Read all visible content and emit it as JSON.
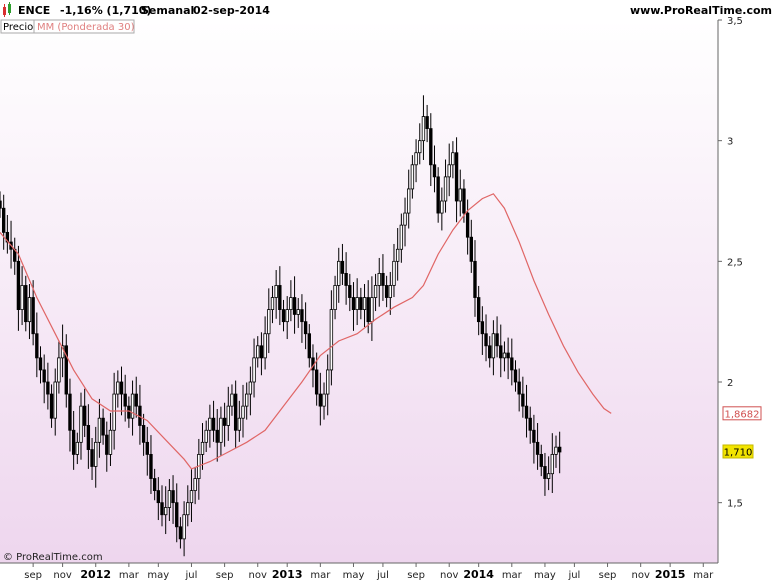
{
  "header": {
    "symbol": "ENCE",
    "change": "-1,16% (1,710)",
    "period": "Semanal",
    "date": "02-sep-2014",
    "website": "www.ProRealTime.com"
  },
  "legend": {
    "price_label": "Precio",
    "ma_label": "MM (Ponderada 30)"
  },
  "watermark": "© ProRealTime.com",
  "colors": {
    "background_top": "#ffffff",
    "background_bottom": "#f0d8f0",
    "candle": "#000000",
    "ma_line": "#e06666",
    "price_badge": "#f2e400",
    "ma_badge_text": "#d05050"
  },
  "chart_data": {
    "type": "candlestick",
    "title": "ENCE -1,16% (1,710) Semanal 02-sep-2014",
    "xlabel": "",
    "ylabel": "",
    "ylim": [
      1.25,
      3.5
    ],
    "y_ticks": [
      1.5,
      2,
      2.5,
      3,
      3.5
    ],
    "y_tick_labels": [
      "1,5",
      "2",
      "2,5",
      "3",
      "3,5"
    ],
    "x_ticks": [
      {
        "label": "sep",
        "week": 0,
        "bold": false
      },
      {
        "label": "nov",
        "week": 8,
        "bold": false
      },
      {
        "label": "2012",
        "week": 17,
        "bold": true
      },
      {
        "label": "mar",
        "week": 26,
        "bold": false
      },
      {
        "label": "may",
        "week": 34,
        "bold": false
      },
      {
        "label": "jul",
        "week": 43,
        "bold": false
      },
      {
        "label": "sep",
        "week": 52,
        "bold": false
      },
      {
        "label": "nov",
        "week": 61,
        "bold": false
      },
      {
        "label": "2013",
        "week": 69,
        "bold": true
      },
      {
        "label": "mar",
        "week": 78,
        "bold": false
      },
      {
        "label": "may",
        "week": 87,
        "bold": false
      },
      {
        "label": "jul",
        "week": 95,
        "bold": false
      },
      {
        "label": "sep",
        "week": 104,
        "bold": false
      },
      {
        "label": "nov",
        "week": 113,
        "bold": false
      },
      {
        "label": "2014",
        "week": 121,
        "bold": true
      },
      {
        "label": "mar",
        "week": 130,
        "bold": false
      },
      {
        "label": "may",
        "week": 139,
        "bold": false
      },
      {
        "label": "jul",
        "week": 147,
        "bold": false
      },
      {
        "label": "sep",
        "week": 156,
        "bold": false
      },
      {
        "label": "nov",
        "week": 165,
        "bold": false
      },
      {
        "label": "2015",
        "week": 173,
        "bold": true
      },
      {
        "label": "mar",
        "week": 182,
        "bold": false
      }
    ],
    "week_range": [
      -9,
      186
    ],
    "close_series": {
      "start_week": -9,
      "values": [
        2.72,
        2.62,
        2.58,
        2.55,
        2.5,
        2.3,
        2.4,
        2.25,
        2.35,
        2.2,
        2.1,
        2.05,
        2.0,
        1.95,
        1.85,
        2.0,
        2.1,
        2.15,
        1.95,
        1.8,
        1.7,
        1.75,
        1.9,
        1.82,
        1.72,
        1.65,
        1.75,
        1.85,
        1.78,
        1.7,
        1.8,
        1.95,
        2.0,
        1.95,
        1.9,
        1.85,
        1.95,
        1.9,
        1.82,
        1.75,
        1.7,
        1.6,
        1.55,
        1.5,
        1.45,
        1.48,
        1.55,
        1.5,
        1.4,
        1.35,
        1.45,
        1.5,
        1.55,
        1.6,
        1.7,
        1.75,
        1.8,
        1.85,
        1.8,
        1.75,
        1.85,
        1.82,
        1.9,
        1.95,
        1.8,
        1.85,
        1.9,
        1.95,
        2.0,
        2.1,
        2.15,
        2.1,
        2.2,
        2.3,
        2.35,
        2.4,
        2.3,
        2.25,
        2.3,
        2.35,
        2.28,
        2.3,
        2.25,
        2.2,
        2.1,
        2.05,
        1.95,
        1.9,
        1.95,
        2.05,
        2.3,
        2.4,
        2.5,
        2.45,
        2.4,
        2.35,
        2.3,
        2.35,
        2.3,
        2.35,
        2.25,
        2.35,
        2.4,
        2.45,
        2.4,
        2.35,
        2.4,
        2.5,
        2.55,
        2.65,
        2.7,
        2.8,
        2.9,
        2.95,
        3.0,
        3.1,
        3.05,
        2.9,
        2.85,
        2.7,
        2.75,
        2.85,
        2.9,
        2.95,
        2.75,
        2.8,
        2.7,
        2.6,
        2.5,
        2.35,
        2.25,
        2.2,
        2.15,
        2.1,
        2.2,
        2.15,
        2.1,
        2.12,
        2.1,
        2.05,
        2.0,
        1.95,
        1.9,
        1.85,
        1.8,
        1.75,
        1.7,
        1.65,
        1.6,
        1.62,
        1.7,
        1.73,
        1.71
      ]
    },
    "ma_series": {
      "name": "MM (Ponderada 30)",
      "points": [
        [
          -9,
          2.62
        ],
        [
          -4,
          2.53
        ],
        [
          1,
          2.35
        ],
        [
          6,
          2.2
        ],
        [
          11,
          2.05
        ],
        [
          16,
          1.93
        ],
        [
          21,
          1.88
        ],
        [
          26,
          1.88
        ],
        [
          31,
          1.84
        ],
        [
          36,
          1.76
        ],
        [
          41,
          1.68
        ],
        [
          43,
          1.64
        ],
        [
          48,
          1.67
        ],
        [
          53,
          1.71
        ],
        [
          58,
          1.75
        ],
        [
          63,
          1.8
        ],
        [
          68,
          1.9
        ],
        [
          73,
          2.0
        ],
        [
          78,
          2.11
        ],
        [
          83,
          2.17
        ],
        [
          88,
          2.2
        ],
        [
          93,
          2.26
        ],
        [
          98,
          2.31
        ],
        [
          103,
          2.35
        ],
        [
          106,
          2.4
        ],
        [
          110,
          2.53
        ],
        [
          114,
          2.63
        ],
        [
          118,
          2.71
        ],
        [
          122,
          2.76
        ],
        [
          125,
          2.78
        ],
        [
          128,
          2.72
        ],
        [
          132,
          2.58
        ],
        [
          136,
          2.42
        ],
        [
          140,
          2.28
        ],
        [
          144,
          2.15
        ],
        [
          148,
          2.04
        ],
        [
          152,
          1.95
        ],
        [
          155,
          1.89
        ],
        [
          157,
          1.87
        ]
      ]
    },
    "last_price": 1.71,
    "last_price_label": "1,710",
    "ma_last_value": 1.8682,
    "ma_last_label": "1,8682"
  }
}
